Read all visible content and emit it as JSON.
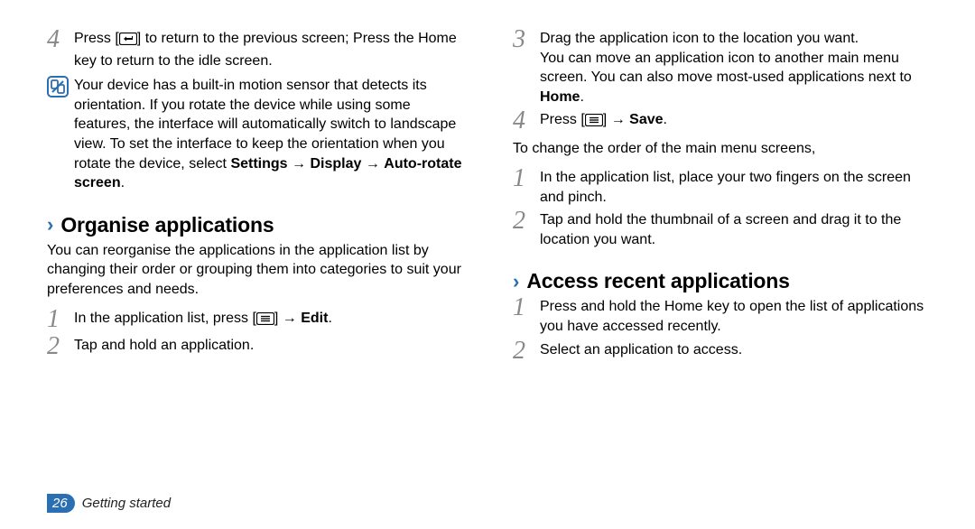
{
  "col_left": {
    "step4_a": "Press [",
    "step4_b": "] to return to the previous screen; Press the Home key to return to the idle screen.",
    "callout_a": "Your device has a built-in motion sensor that detects its orientation. If you rotate the device while using some features, the interface will automatically switch to landscape view. To set the interface to keep the orientation when you rotate the device, select ",
    "callout_b1": "Settings",
    "callout_arrow1": " → ",
    "callout_b2": "Display",
    "callout_arrow2": " → ",
    "callout_b3": "Auto-rotate screen",
    "callout_end": ".",
    "heading1": "Organise applications",
    "para1": "You can reorganise the applications in the application list by changing their order or grouping them into categories to suit your preferences and needs.",
    "s1_a": "In the application list, press [",
    "s1_b": "] → ",
    "s1_c": "Edit",
    "s1_end": ".",
    "s2": "Tap and hold an application."
  },
  "col_right": {
    "s3a": "Drag the application icon to the location you want.",
    "s3b_a": "You can move an application icon to another main menu screen. You can also move most-used applications next to ",
    "s3b_b": "Home",
    "s3b_end": ".",
    "s4_a": "Press [",
    "s4_b": "] → ",
    "s4_c": "Save",
    "s4_end": ".",
    "para2": "To change the order of the main menu screens,",
    "r1": "In the application list, place your two fingers on the screen and pinch.",
    "r2": "Tap and hold the thumbnail of a screen and drag it to the location you want.",
    "heading2": "Access recent applications",
    "a1": "Press and hold the Home key to open the list of applications you have accessed recently.",
    "a2": "Select an application to access."
  },
  "footer": {
    "page": "26",
    "section": "Getting started"
  },
  "nums": {
    "n1": "1",
    "n2": "2",
    "n3": "3",
    "n4": "4"
  }
}
